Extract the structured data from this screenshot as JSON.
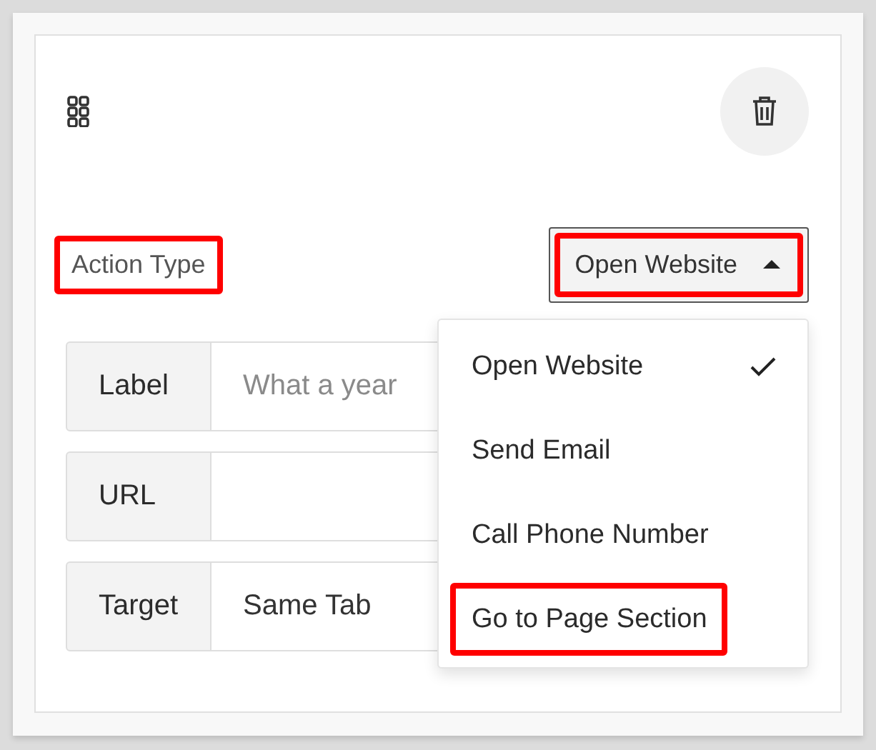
{
  "action_type": {
    "label": "Action Type",
    "highlighted": true
  },
  "dropdown": {
    "value": "Open Website",
    "expanded": true,
    "highlighted": true
  },
  "fields": [
    {
      "label": "Label",
      "placeholder": "What a year"
    },
    {
      "label": "URL"
    },
    {
      "label": "Target",
      "value": "Same Tab"
    }
  ],
  "menu": {
    "items": [
      {
        "label": "Open Website",
        "selected": true,
        "highlighted": false
      },
      {
        "label": "Send Email",
        "selected": false,
        "highlighted": false
      },
      {
        "label": "Call Phone Number",
        "selected": false,
        "highlighted": false
      },
      {
        "label": "Go to Page Section",
        "selected": false,
        "highlighted": true
      }
    ]
  }
}
